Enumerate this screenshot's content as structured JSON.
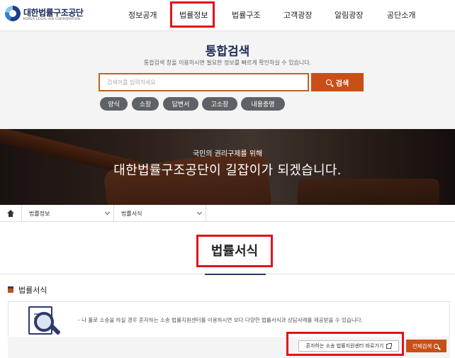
{
  "logo": {
    "name": "대한법률구조공단",
    "subtitle": "KOREA LEGAL AID CORPORATION"
  },
  "nav": {
    "items": [
      {
        "label": "정보공개"
      },
      {
        "label": "법률정보"
      },
      {
        "label": "법률구조"
      },
      {
        "label": "고객광장"
      },
      {
        "label": "알림광장"
      },
      {
        "label": "공단소개"
      }
    ]
  },
  "search": {
    "title": "통합검색",
    "description": "통합검색 창을 이용하시면 필요한 정보를 빠르게 확인하실 수 있습니다.",
    "placeholder": "검색어를 입력하세요",
    "button_label": "검색",
    "tags": [
      "양식",
      "소장",
      "답변서",
      "고소장",
      "내용증명"
    ]
  },
  "banner": {
    "subtitle": "국민의 권리구제를 위해",
    "headline": "대한법률구조공단이 길잡이가 되겠습니다."
  },
  "breadcrumb": {
    "level1": "법률정보",
    "level2": "법률서식"
  },
  "page": {
    "title": "법률서식"
  },
  "section": {
    "title": "법률서식",
    "info_text": "- 나 홀로 소송을 하실 경우 혼자하는 소송 법률지원센터를 이용하시면 보다 다양한 법률서식과 상담사례를 제공받을 수 있습니다.",
    "center_link_label": "혼자하는 소송 법률지원센터 바로가기",
    "full_search_label": "전체검색"
  },
  "colors": {
    "accent": "#c94f17",
    "navy": "#1d2d5a",
    "highlight": "#e2131c"
  }
}
